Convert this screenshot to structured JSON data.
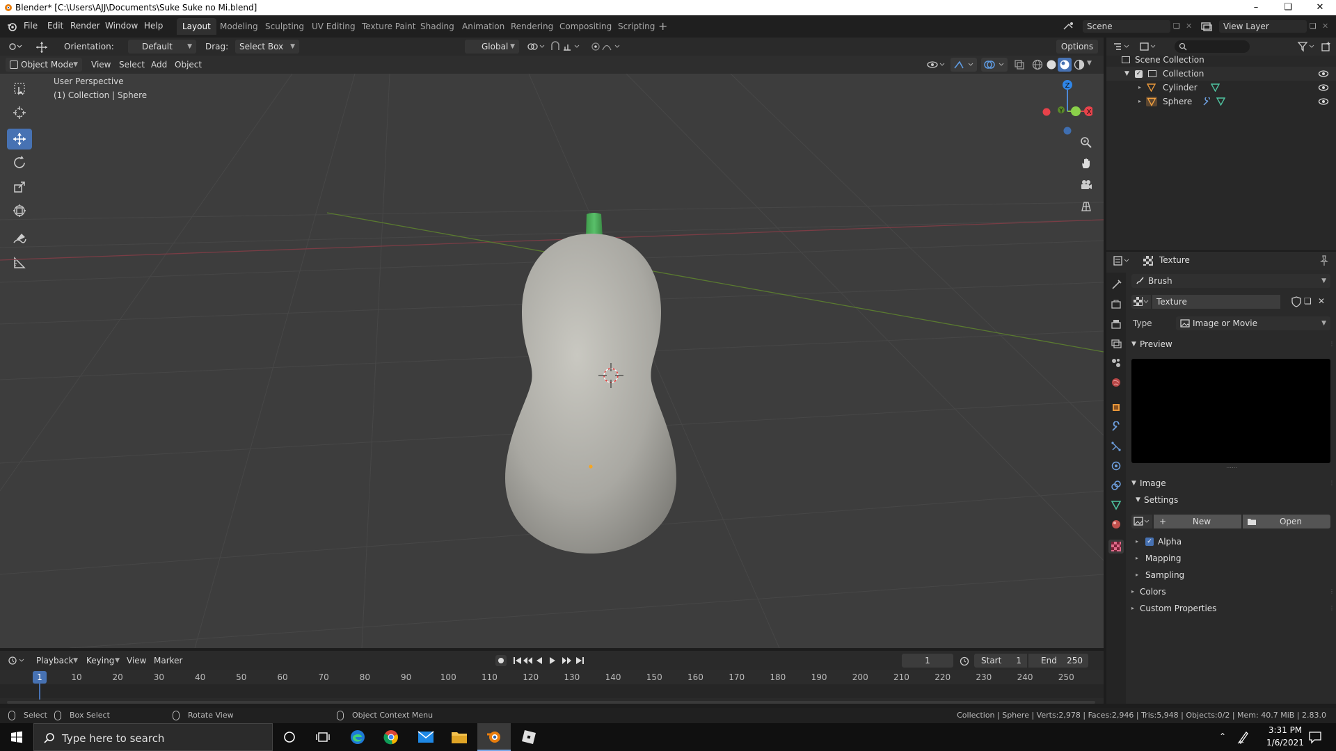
{
  "window": {
    "title": "Blender* [C:\\Users\\AJJ\\Documents\\Suke Suke no Mi.blend]"
  },
  "menus": [
    "File",
    "Edit",
    "Render",
    "Window",
    "Help"
  ],
  "workspaces": [
    "Layout",
    "Modeling",
    "Sculpting",
    "UV Editing",
    "Texture Paint",
    "Shading",
    "Animation",
    "Rendering",
    "Compositing",
    "Scripting"
  ],
  "scene": {
    "name": "Scene",
    "view_layer": "View Layer"
  },
  "tool_header": {
    "orientation_label": "Orientation:",
    "orientation_value": "Default",
    "drag_label": "Drag:",
    "drag_value": "Select Box",
    "transform_space": "Global",
    "options": "Options"
  },
  "viewport_header": {
    "mode": "Object Mode",
    "menus": [
      "View",
      "Select",
      "Add",
      "Object"
    ]
  },
  "viewport": {
    "perspective": "User Perspective",
    "context": "(1) Collection | Sphere"
  },
  "gizmo": {
    "z": "Z",
    "y": "Y",
    "x": "X"
  },
  "outliner": {
    "scene_collection": "Scene Collection",
    "collection": "Collection",
    "items": [
      "Cylinder",
      "Sphere"
    ]
  },
  "properties": {
    "title": "Texture",
    "brush": "Brush",
    "texture_name": "Texture",
    "type_label": "Type",
    "type_value": "Image or Movie",
    "preview": "Preview",
    "image": "Image",
    "settings": "Settings",
    "new": "New",
    "open": "Open",
    "alpha": "Alpha",
    "mapping": "Mapping",
    "sampling": "Sampling",
    "colors": "Colors",
    "custom_properties": "Custom Properties"
  },
  "timeline": {
    "menus": [
      "Playback",
      "Keying",
      "View",
      "Marker"
    ],
    "current_frame": "1",
    "start_label": "Start",
    "start": "1",
    "end_label": "End",
    "end": "250",
    "ticks": [
      "1",
      "10",
      "20",
      "30",
      "40",
      "50",
      "60",
      "70",
      "80",
      "90",
      "100",
      "110",
      "120",
      "130",
      "140",
      "150",
      "160",
      "170",
      "180",
      "190",
      "200",
      "210",
      "220",
      "230",
      "240",
      "250"
    ]
  },
  "statusbar": {
    "select": "Select",
    "box_select": "Box Select",
    "rotate_view": "Rotate View",
    "context_menu": "Object Context Menu",
    "stats": "Collection | Sphere | Verts:2,978 | Faces:2,946 | Tris:5,948 | Objects:0/2 | Mem: 40.7 MiB | 2.83.0"
  },
  "taskbar": {
    "search_placeholder": "Type here to search",
    "time": "3:31 PM",
    "date": "1/6/2021"
  },
  "colors": {
    "accent": "#4772b3",
    "selected_orange": "#f5a623",
    "stem_green": "#4caf50"
  }
}
